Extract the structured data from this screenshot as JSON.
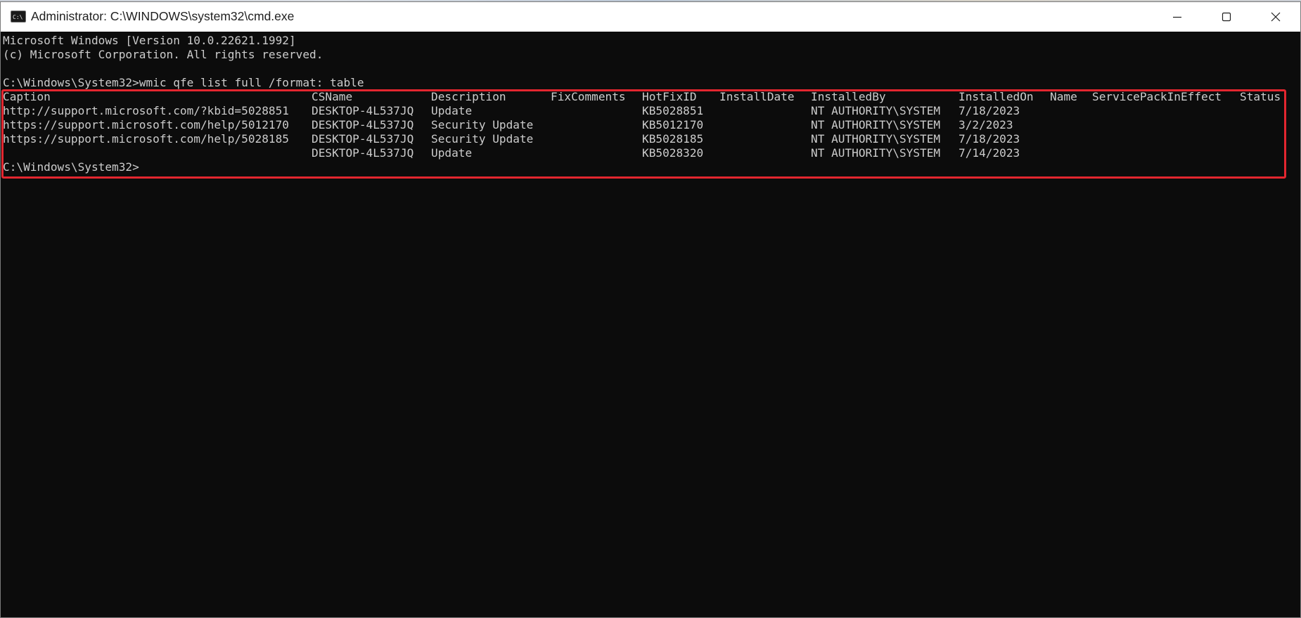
{
  "window": {
    "title": "Administrator: C:\\WINDOWS\\system32\\cmd.exe",
    "icon": "cmd-console-icon",
    "controls": [
      "minimize-icon",
      "maximize-icon",
      "close-icon"
    ]
  },
  "console": {
    "banner_line1": "Microsoft Windows [Version 10.0.22621.1992]",
    "banner_line2": "(c) Microsoft Corporation. All rights reserved.",
    "command_prompt": "C:\\Windows\\System32>",
    "command": "wmic qfe list full /format: table",
    "final_prompt": "C:\\Windows\\System32>",
    "highlight_color": "#e3262f",
    "text_color": "#cccccc",
    "background_color": "#0c0c0c"
  },
  "table": {
    "headers": [
      "Caption",
      "CSName",
      "Description",
      "FixComments",
      "HotFixID",
      "InstallDate",
      "InstalledBy",
      "InstalledOn",
      "Name",
      "ServicePackInEffect",
      "Status"
    ],
    "rows": [
      [
        "http://support.microsoft.com/?kbid=5028851",
        "DESKTOP-4L537JQ",
        "Update",
        "",
        "KB5028851",
        "",
        "NT AUTHORITY\\SYSTEM",
        "7/18/2023",
        "",
        "",
        ""
      ],
      [
        "https://support.microsoft.com/help/5012170",
        "DESKTOP-4L537JQ",
        "Security Update",
        "",
        "KB5012170",
        "",
        "NT AUTHORITY\\SYSTEM",
        "3/2/2023",
        "",
        "",
        ""
      ],
      [
        "https://support.microsoft.com/help/5028185",
        "DESKTOP-4L537JQ",
        "Security Update",
        "",
        "KB5028185",
        "",
        "NT AUTHORITY\\SYSTEM",
        "7/18/2023",
        "",
        "",
        ""
      ],
      [
        "",
        "DESKTOP-4L537JQ",
        "Update",
        "",
        "KB5028320",
        "",
        "NT AUTHORITY\\SYSTEM",
        "7/14/2023",
        "",
        "",
        ""
      ]
    ]
  }
}
